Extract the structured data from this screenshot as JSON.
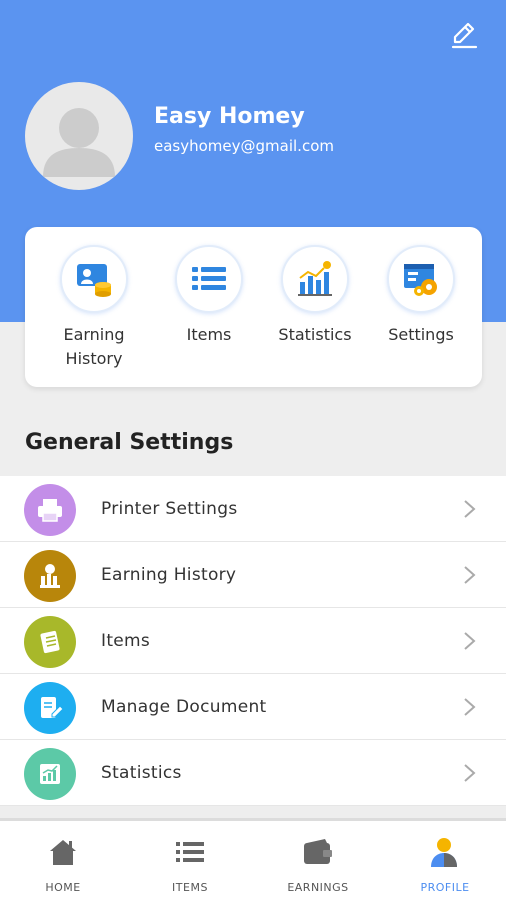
{
  "colors": {
    "primary": "#5b94f0",
    "background": "#eeeeee",
    "active_nav": "#4c8df0"
  },
  "profile": {
    "name": "Easy Homey",
    "email": "easyhomey@gmail.com",
    "avatar_icon": "user-avatar-icon",
    "edit_icon": "pencil-icon"
  },
  "quick_actions": [
    {
      "line1": "Earning",
      "line2": "History",
      "icon": "earning-history-icon"
    },
    {
      "line1": "Items",
      "line2": "",
      "icon": "list-icon"
    },
    {
      "line1": "Statistics",
      "line2": "",
      "icon": "bar-chart-icon"
    },
    {
      "line1": "Settings",
      "line2": "",
      "icon": "settings-gears-icon"
    }
  ],
  "general_settings": {
    "title": "General Settings",
    "items": [
      {
        "label": "Printer Settings",
        "icon": "printer-icon",
        "color": "#c38ee8"
      },
      {
        "label": "Earning History",
        "icon": "money-bag-icon",
        "color": "#b8860b"
      },
      {
        "label": "Items",
        "icon": "checklist-icon",
        "color": "#a8b82a"
      },
      {
        "label": "Manage Document",
        "icon": "document-edit-icon",
        "color": "#1eaef0"
      },
      {
        "label": "Statistics",
        "icon": "chart-up-icon",
        "color": "#5cc9a7"
      }
    ]
  },
  "bottom_nav": [
    {
      "label": "HOME",
      "icon": "home-icon",
      "active": false
    },
    {
      "label": "ITEMS",
      "icon": "list-icon",
      "active": false
    },
    {
      "label": "EARNINGS",
      "icon": "wallet-icon",
      "active": false
    },
    {
      "label": "PROFILE",
      "icon": "profile-icon",
      "active": true
    }
  ]
}
